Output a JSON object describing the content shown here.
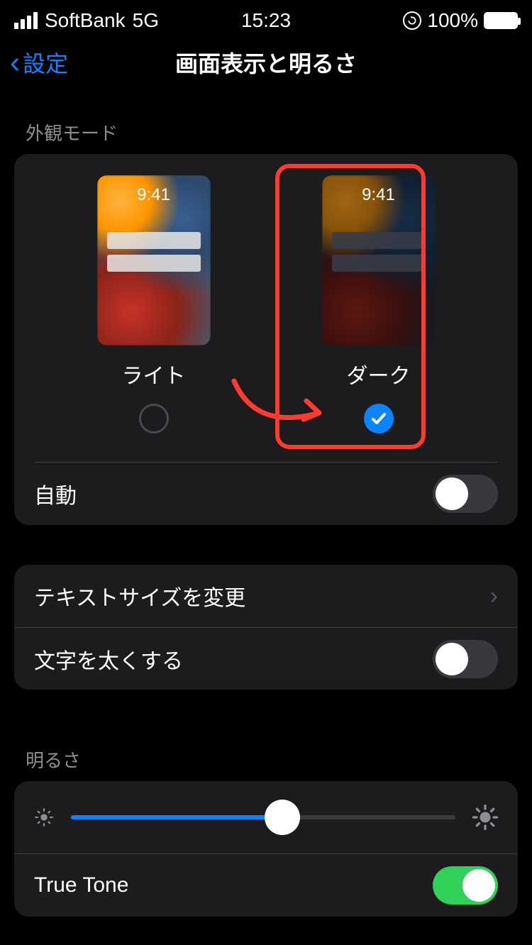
{
  "status": {
    "carrier": "SoftBank",
    "network": "5G",
    "time": "15:23",
    "battery_pct": "100%"
  },
  "nav": {
    "back_label": "設定",
    "title": "画面表示と明るさ"
  },
  "appearance": {
    "section_label": "外観モード",
    "preview_time": "9:41",
    "light": {
      "label": "ライト",
      "selected": false
    },
    "dark": {
      "label": "ダーク",
      "selected": true
    },
    "auto_row_label": "自動",
    "auto_on": false
  },
  "text": {
    "text_size_label": "テキストサイズを変更",
    "bold_label": "文字を太くする",
    "bold_on": false
  },
  "brightness": {
    "section_label": "明るさ",
    "value_pct": 55,
    "true_tone_label": "True Tone",
    "true_tone_on": true
  },
  "annotation": {
    "arrow_color": "#ff3b30"
  }
}
